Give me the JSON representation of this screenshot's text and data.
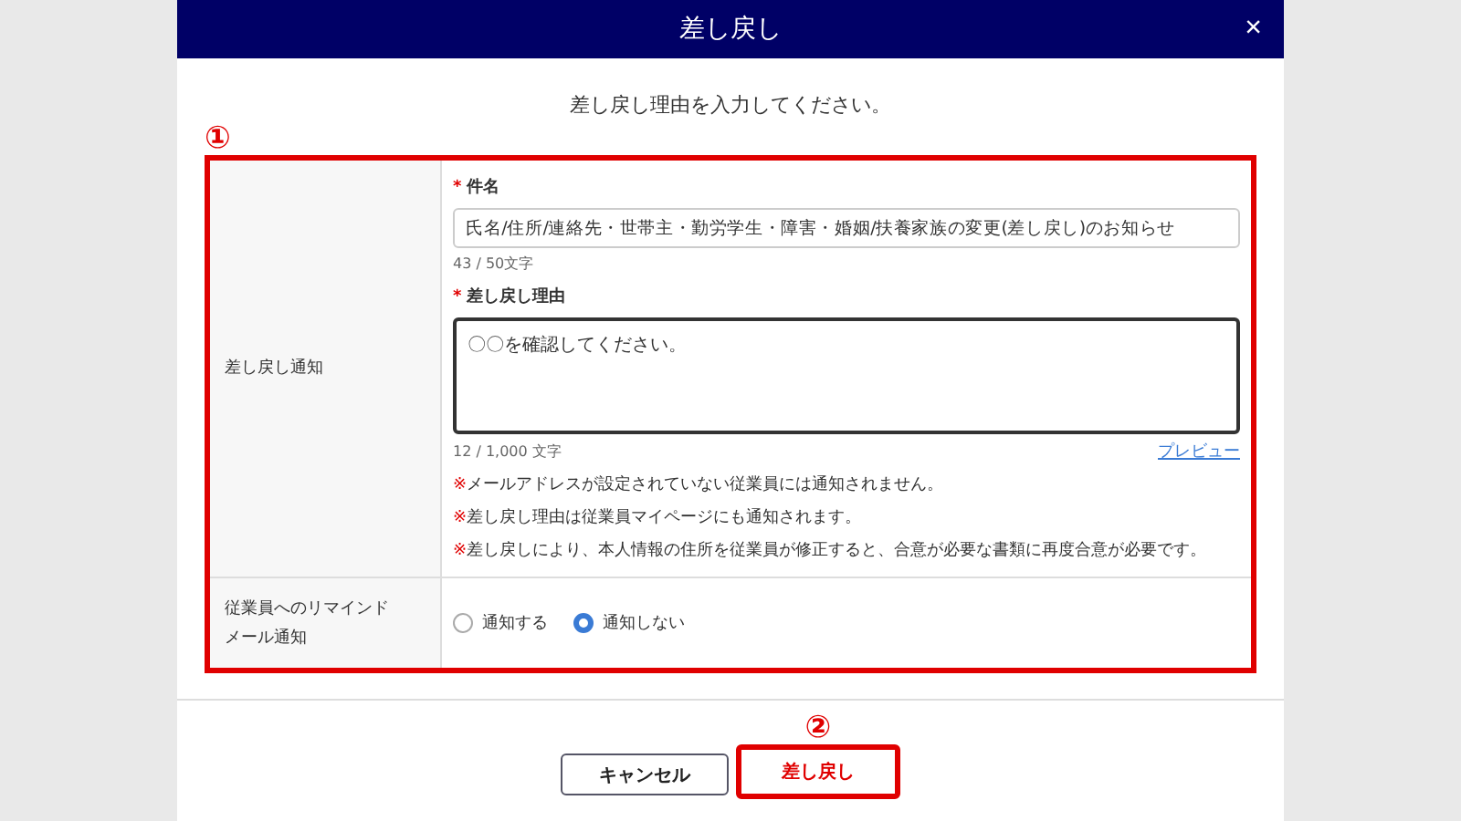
{
  "dialog": {
    "title": "差し戻し",
    "close": "×",
    "instruction": "差し戻し理由を入力してください。"
  },
  "annotations": [
    "①",
    "②"
  ],
  "form": {
    "rows": [
      {
        "kind": "notice",
        "label": "差し戻し通知",
        "subject": {
          "label": "件名",
          "required_mark": "*",
          "value": "氏名/住所/連絡先・世帯主・勤労学生・障害・婚姻/扶養家族の変更(差し戻し)のお知らせ",
          "count": "43 / 50文字"
        },
        "reason": {
          "label": "差し戻し理由",
          "required_mark": "*",
          "value": "〇〇を確認してください。",
          "count": "12 / 1,000 文字",
          "preview": "プレビュー"
        },
        "notes": [
          {
            "mark": "※",
            "text": "メールアドレスが設定されていない従業員には通知されません。"
          },
          {
            "mark": "※",
            "text": "差し戻し理由は従業員マイページにも通知されます。"
          },
          {
            "mark": "※",
            "text": "差し戻しにより、本人情報の住所を従業員が修正すると、合意が必要な書類に再度合意が必要です。"
          }
        ]
      },
      {
        "kind": "radio",
        "label_lines": [
          "従業員へのリマインド",
          "メール通知"
        ],
        "options": [
          {
            "label": "通知する",
            "selected": false
          },
          {
            "label": "通知しない",
            "selected": true
          }
        ]
      }
    ]
  },
  "buttons": [
    {
      "kind": "cancel",
      "label": "キャンセル"
    },
    {
      "kind": "submit",
      "label": "差し戻し"
    }
  ]
}
